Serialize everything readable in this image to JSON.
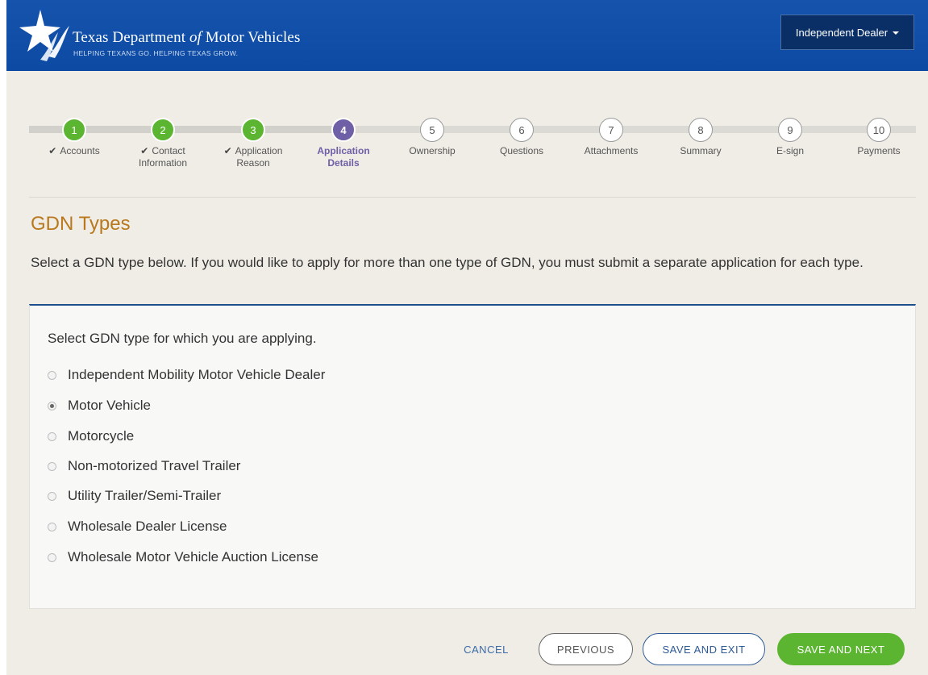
{
  "header": {
    "brand_title_main": "Texas Department ",
    "brand_title_of": "of",
    "brand_title_end": " Motor Vehicles",
    "brand_subtitle": "HELPING TEXANS GO. HELPING TEXAS GROW.",
    "account_menu_label": "Independent Dealer",
    "brand_color": "#0f4fa8"
  },
  "stepper": {
    "steps": [
      {
        "number": "1",
        "label_line1": "Accounts",
        "label_line2": "",
        "state": "done"
      },
      {
        "number": "2",
        "label_line1": "Contact",
        "label_line2": "Information",
        "state": "done"
      },
      {
        "number": "3",
        "label_line1": "Application",
        "label_line2": "Reason",
        "state": "done"
      },
      {
        "number": "4",
        "label_line1": "Application",
        "label_line2": "Details",
        "state": "active"
      },
      {
        "number": "5",
        "label_line1": "Ownership",
        "label_line2": "",
        "state": "todo"
      },
      {
        "number": "6",
        "label_line1": "Questions",
        "label_line2": "",
        "state": "todo"
      },
      {
        "number": "7",
        "label_line1": "Attachments",
        "label_line2": "",
        "state": "todo"
      },
      {
        "number": "8",
        "label_line1": "Summary",
        "label_line2": "",
        "state": "todo"
      },
      {
        "number": "9",
        "label_line1": "E-sign",
        "label_line2": "",
        "state": "todo"
      },
      {
        "number": "10",
        "label_line1": "Payments",
        "label_line2": "",
        "state": "todo"
      }
    ],
    "done_color": "#5cb531",
    "active_color": "#6f5fa7"
  },
  "main": {
    "title": "GDN Types",
    "description": "Select a GDN type below. If you would like to apply for more than one type of GDN, you must submit a separate application for each type.",
    "prompt": "Select GDN type for which you are applying.",
    "options": [
      {
        "label": "Independent Mobility Motor Vehicle Dealer",
        "selected": false
      },
      {
        "label": "Motor Vehicle",
        "selected": true
      },
      {
        "label": "Motorcycle",
        "selected": false
      },
      {
        "label": "Non-motorized Travel Trailer",
        "selected": false
      },
      {
        "label": "Utility Trailer/Semi-Trailer",
        "selected": false
      },
      {
        "label": "Wholesale Dealer License",
        "selected": false
      },
      {
        "label": "Wholesale Motor Vehicle Auction License",
        "selected": false
      }
    ],
    "title_color": "#b9781d"
  },
  "footer": {
    "cancel_label": "CANCEL",
    "previous_label": "PREVIOUS",
    "save_exit_label": "SAVE AND EXIT",
    "save_next_label": "SAVE AND NEXT"
  }
}
